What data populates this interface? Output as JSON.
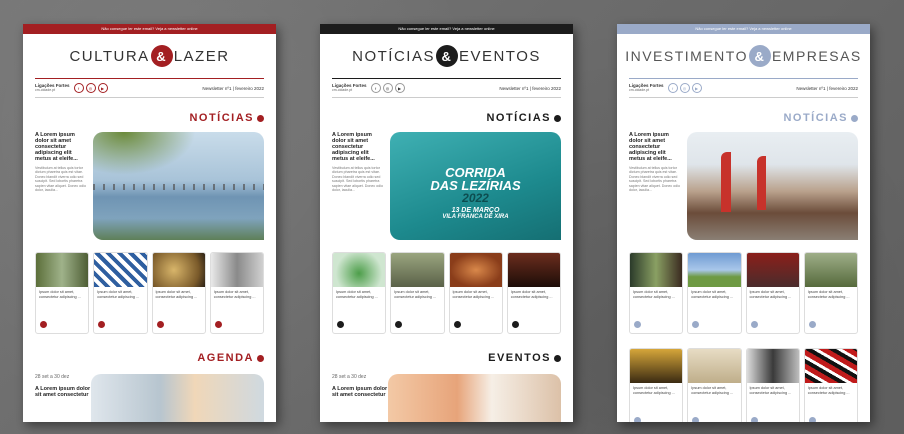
{
  "colors": {
    "culture": "#a31f22",
    "news": "#1c1c1c",
    "invest": "#9aaac8"
  },
  "pages": [
    {
      "topbar": "Não consegue ler este email? Veja a newsletter online",
      "title_left": "CULTURA",
      "amp": "&",
      "title_right": "LAZER",
      "brand": "Ligações Fortes",
      "brand_sub": "cm-cidade.pt",
      "newsletter": "Newsletter nº1 | fevereiro 2022",
      "section": "NOTÍCIAS",
      "feature_title": "A Lorem ipsum dolor sit amet consectetur adipiscing elit metus at eleife...",
      "feature_body": "Vestibulum at tellus quis tortor dictum pharetra quis est vitae. Donec blandit viverra odio sed suscipit. Sed lobortis pharetra sapien vitae aliquet. Donec odio dolor, iaculia...",
      "card_text": "Ipsum dolor sit amet, consectetur adipiscing ...",
      "section2": "AGENDA",
      "agenda_date": "28 set a 30 dez",
      "agenda_title": "A Lorem ipsum dolor sit amet consectetur"
    },
    {
      "topbar": "Não consegue ler este email? Veja a newsletter online",
      "title_left": "NOTÍCIAS",
      "amp": "&",
      "title_right": "EVENTOS",
      "brand": "Ligações Fortes",
      "brand_sub": "cm-cidade.pt",
      "newsletter": "Newsletter nº1 | fevereiro 2022",
      "section": "NOTÍCIAS",
      "feature_title": "A Lorem ipsum dolor sit amet consectetur adipiscing elit metus at eleife...",
      "feature_body": "Vestibulum at tellus quis tortor dictum pharetra quis est vitae. Donec blandit viverra odio sed suscipit. Sed lobortis pharetra sapien vitae aliquet. Donec odio dolor, iaculia...",
      "poster_line1": "CORRIDA",
      "poster_line2": "DAS LEZÍRIAS",
      "poster_year": "2022",
      "poster_date": "13 DE MARÇO",
      "poster_place": "VILA FRANCA DE XIRA",
      "card_text": "Ipsum dolor sit amet, consectetur adipiscing ...",
      "section2": "EVENTOS",
      "agenda_date": "28 set a 30 dez",
      "agenda_title": "A Lorem ipsum dolor sit amet consectetur"
    },
    {
      "topbar": "Não consegue ler este email? Veja a newsletter online",
      "title_left": "INVESTIMENTO",
      "amp": "&",
      "title_right": "EMPRESAS",
      "brand": "Ligações Fortes",
      "brand_sub": "cm-cidade.pt",
      "newsletter": "Newsletter nº1 | fevereiro 2022",
      "section": "NOTÍCIAS",
      "feature_title": "A Lorem ipsum dolor sit amet consectetur adipiscing elit metus at eleife...",
      "feature_body": "Vestibulum at tellus quis tortor dictum pharetra quis est vitae. Donec blandit viverra odio sed suscipit. Sed lobortis pharetra sapien vitae aliquet. Donec odio dolor, iaculia...",
      "card_text": "Ipsum dolor sit amet, consectetur adipiscing ..."
    }
  ]
}
